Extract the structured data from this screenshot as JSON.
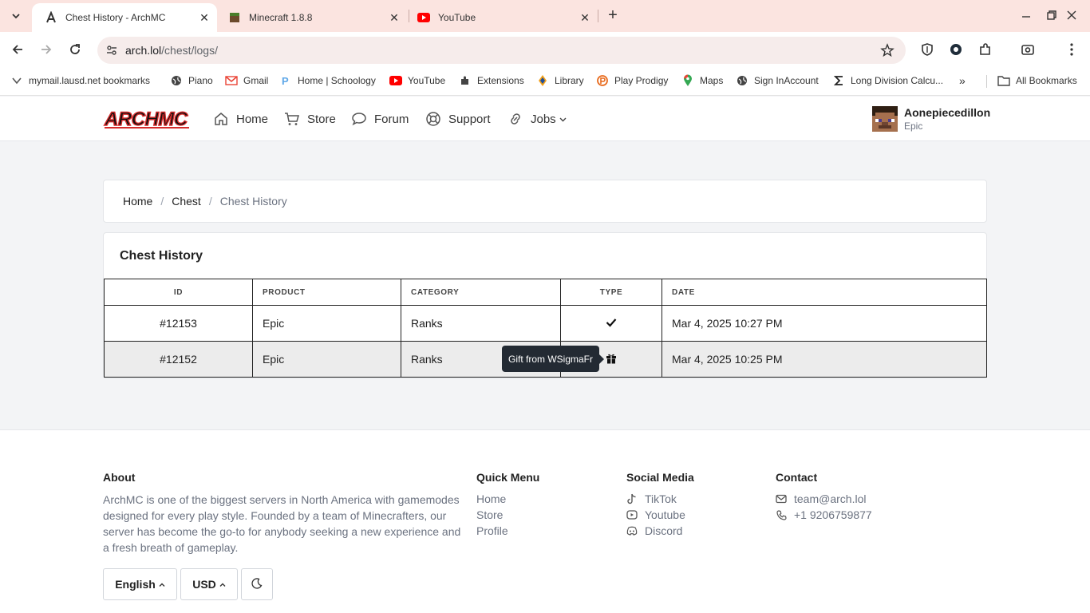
{
  "browser": {
    "tabs": [
      {
        "title": "Chest History - ArchMC",
        "active": true
      },
      {
        "title": "Minecraft 1.8.8",
        "active": false
      },
      {
        "title": "YouTube",
        "active": false
      }
    ],
    "url_host": "arch.lol",
    "url_path": "/chest/logs/",
    "bookmarks": [
      {
        "label": "mymail.lausd.net bookmarks",
        "icon": "chevron-bookmark-icon"
      },
      {
        "label": "Piano",
        "icon": "globe-icon"
      },
      {
        "label": "Gmail",
        "icon": "gmail-icon"
      },
      {
        "label": "Home | Schoology",
        "icon": "schoology-icon"
      },
      {
        "label": "YouTube",
        "icon": "youtube-icon"
      },
      {
        "label": "Extensions",
        "icon": "puzzle-icon"
      },
      {
        "label": "Library",
        "icon": "library-icon"
      },
      {
        "label": "Play Prodigy",
        "icon": "prodigy-icon"
      },
      {
        "label": "Maps",
        "icon": "maps-pin-icon"
      },
      {
        "label": "Sign InAccount",
        "icon": "globe-icon"
      },
      {
        "label": "Long Division Calcu...",
        "icon": "sigma-icon"
      }
    ],
    "all_bookmarks": "All Bookmarks"
  },
  "site": {
    "brand": "ARCHMC",
    "nav": [
      {
        "label": "Home",
        "icon": "home-icon"
      },
      {
        "label": "Store",
        "icon": "cart-icon"
      },
      {
        "label": "Forum",
        "icon": "chat-bubble-icon"
      },
      {
        "label": "Support",
        "icon": "lifebuoy-icon"
      },
      {
        "label": "Jobs",
        "icon": "link-icon"
      }
    ],
    "user": {
      "name": "Aonepiecedillon",
      "rank": "Epic"
    }
  },
  "breadcrumb": {
    "items": [
      "Home",
      "Chest"
    ],
    "current": "Chest History"
  },
  "history": {
    "title": "Chest History",
    "columns": [
      "ID",
      "PRODUCT",
      "CATEGORY",
      "TYPE",
      "DATE"
    ],
    "rows": [
      {
        "id": "#12153",
        "product": "Epic",
        "category": "Ranks",
        "type": "check-icon",
        "date": "Mar 4, 2025 10:27 PM"
      },
      {
        "id": "#12152",
        "product": "Epic",
        "category": "Ranks",
        "type": "gift-icon",
        "date": "Mar 4, 2025 10:25 PM"
      }
    ],
    "tooltip": "Gift from WSigmaFr"
  },
  "footer": {
    "about_heading": "About",
    "about_text": "ArchMC is one of the biggest servers in North America with gamemodes designed for every play style. Founded by a team of Minecrafters, our server has become the go-to for anybody seeking a new experience and a fresh breath of gameplay.",
    "quick_heading": "Quick Menu",
    "quick_links": [
      "Home",
      "Store",
      "Profile"
    ],
    "social_heading": "Social Media",
    "social_links": [
      {
        "label": "TikTok",
        "icon": "tiktok-icon"
      },
      {
        "label": "Youtube",
        "icon": "youtube-play-icon"
      },
      {
        "label": "Discord",
        "icon": "discord-icon"
      }
    ],
    "contact_heading": "Contact",
    "contact": [
      {
        "label": "team@arch.lol",
        "icon": "mail-icon"
      },
      {
        "label": "+1 9206759877",
        "icon": "phone-icon"
      }
    ],
    "language": "English",
    "currency": "USD",
    "theme_icon": "moon-icon"
  },
  "colors": {
    "tabbar": "#fbe4e0",
    "page_bg": "#f3f4f6",
    "tooltip_bg": "#232a33",
    "brand_red": "#d62b2b"
  }
}
